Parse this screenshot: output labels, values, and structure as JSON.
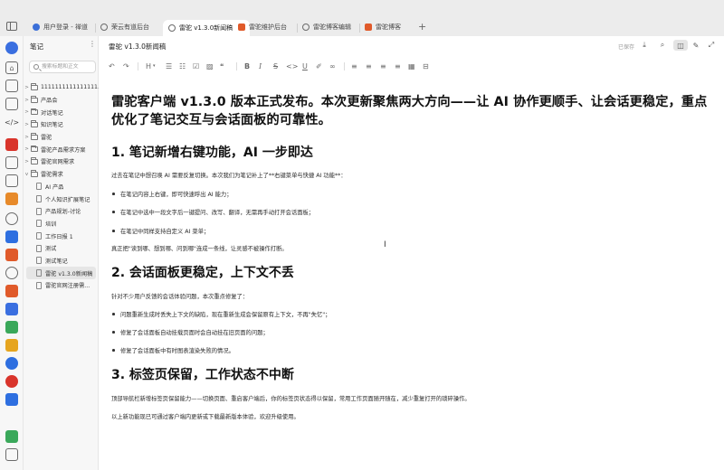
{
  "tabs": [
    {
      "label": "用户登录 - 禅道",
      "icon_color": "#3b6fd8"
    },
    {
      "label": "荣云有道后台",
      "icon_color": "#6a6a6a"
    },
    {
      "label": "雷驼 v1.3.0新闻稿",
      "icon_color": "#6a6a6a",
      "active": true
    },
    {
      "label": "雷驼维护后台",
      "icon_color": "#e05a2a"
    },
    {
      "label": "雷驼博客编辑",
      "icon_color": "#6a6a6a"
    },
    {
      "label": "雷驼博客",
      "icon_color": "#e05a2a"
    }
  ],
  "tab_close_glyph": "×",
  "tab_add_glyph": "+",
  "panel": {
    "title": "笔记",
    "more_glyph": "⋮",
    "search_placeholder": "搜索标题和正文",
    "tree": [
      {
        "label": "1111111111111111...",
        "type": "folder"
      },
      {
        "label": "产品会",
        "type": "folder"
      },
      {
        "label": "对话笔记",
        "type": "folder"
      },
      {
        "label": "知识笔记",
        "type": "folder"
      },
      {
        "label": "雷驼",
        "type": "folder"
      },
      {
        "label": "雷驼产品需求方案",
        "type": "folder"
      },
      {
        "label": "雷驼官网需求",
        "type": "folder"
      },
      {
        "label": "雷驼需求",
        "type": "folder"
      },
      {
        "label": "AI 产品",
        "type": "doc"
      },
      {
        "label": "个人知识扩展笔记",
        "type": "doc"
      },
      {
        "label": "产品规划-讨论",
        "type": "doc"
      },
      {
        "label": "培训",
        "type": "doc"
      },
      {
        "label": "工作日报 1",
        "type": "doc"
      },
      {
        "label": "测试",
        "type": "doc"
      },
      {
        "label": "测试笔记",
        "type": "doc"
      },
      {
        "label": "雷驼 v1.3.0新闻稿",
        "type": "doc",
        "active": true
      },
      {
        "label": "雷驼官网注册需...",
        "type": "doc"
      }
    ]
  },
  "editor": {
    "doc_title": "雷驼 v1.3.0新闻稿",
    "save_status": "已保存"
  },
  "toolbar": {
    "heading_label": "H",
    "bold": "B",
    "italic": "I",
    "strike": "S",
    "underline": "U"
  },
  "article": {
    "lead": "雷驼客户端 v1.3.0 版本正式发布。本次更新聚焦两大方向——让 AI 协作更顺手、让会话更稳定，重点优化了笔记交互与会话面板的可靠性。",
    "sections": [
      {
        "heading": "1. 笔记新增右键功能，AI 一步即达",
        "intro": "过去在笔记中想召唤 AI 需要反复切换。本次我们为笔记补上了**右键菜单与快捷 AI 功能**：",
        "bullets": [
          "在笔记内容上右键，即可快速呼出 AI 能力；",
          "在笔记中选中一段文字后一键提问、改写、翻译，无需再手动打开会话面板；",
          "在笔记中同样支持自定义 AI 菜单；"
        ],
        "outro": "真正把\"读到哪、想到哪、问到哪\"连成一条线，让灵感不被操作打断。"
      },
      {
        "heading": "2. 会话面板更稳定，上下文不丢",
        "intro": "针对不少用户反馈的会话体验问题，本次重点修复了：",
        "bullets": [
          "问题重新生成时丢失上下文的缺陷，现在重新生成会保留原有上下文，不再\"失忆\"；",
          "修复了会话面板自动挂载页面时会自动挂在旧页面的问题；",
          "修复了会话面板中有时图表渲染失败的情况。"
        ]
      },
      {
        "heading": "3. 标签页保留，工作状态不中断",
        "intro": "顶部导航栏新增标签页保留能力——切换页面、重启客户端后，你的标签页状态得以保留，常用工作页面随开随在，减少重复打开的琐碎操作。",
        "outro": "以上新功能现已可通过客户端内更新或下载最新版本体验，欢迎升级使用。"
      }
    ]
  }
}
